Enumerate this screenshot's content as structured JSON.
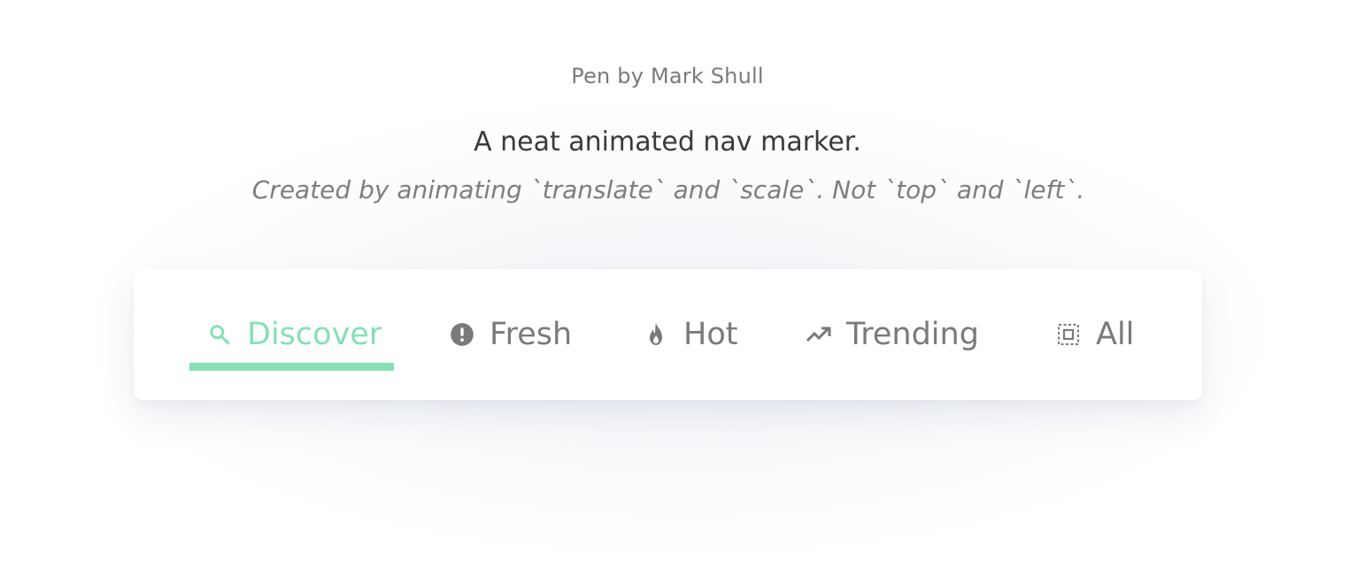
{
  "header": {
    "credit": "Pen by Mark Shull",
    "headline": "A neat animated nav marker.",
    "subline": "Created by animating `translate` and `scale`. Not `top` and `left`."
  },
  "nav": {
    "active_index": 0,
    "items": [
      {
        "label": "Discover",
        "icon": "search-icon"
      },
      {
        "label": "Fresh",
        "icon": "alert-circle-icon"
      },
      {
        "label": "Hot",
        "icon": "flame-icon"
      },
      {
        "label": "Trending",
        "icon": "trending-up-icon"
      },
      {
        "label": "All",
        "icon": "select-all-icon"
      }
    ]
  },
  "colors": {
    "accent": "#84e1b4",
    "text_muted": "#7a7a7a",
    "text_dark": "#3a3a3a"
  }
}
